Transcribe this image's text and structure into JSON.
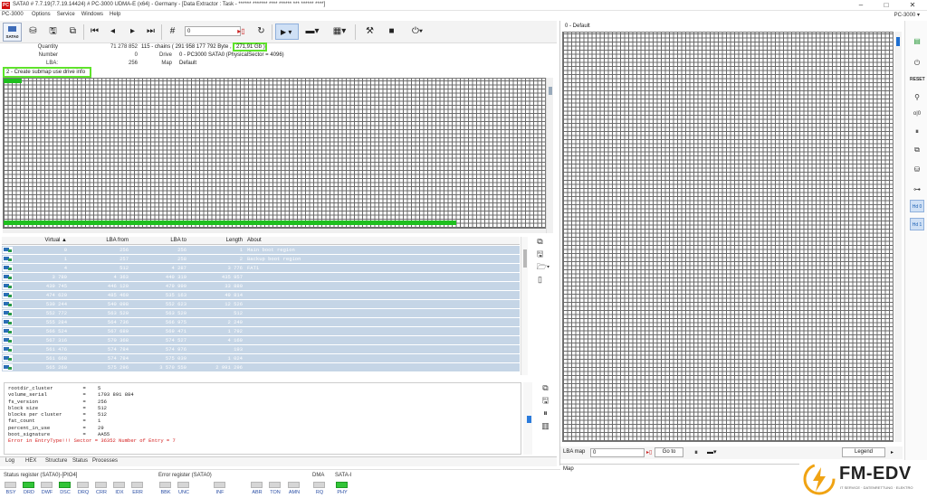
{
  "titlebar": {
    "title": "SATA0 # 7.7.19(7.7.19.14424) # PC-3000 UDMA-E (x64) - Germany - [Data Extractor : Task - ****** ******* **** ****** *** ****** ****]",
    "app_icon": "PC"
  },
  "menubar": {
    "app_label": "PC-3000",
    "items": [
      "Options",
      "Service",
      "Windows",
      "Help"
    ],
    "right_label": "PC-3000 ▾"
  },
  "toolbar": {
    "sata0_label": "SATA0",
    "lba_value": "0"
  },
  "info": {
    "quantity_label": "Quantity",
    "quantity_value": "71 278 852",
    "chains_text": "115 - chains ( 291 958 177 792 Byte ,",
    "size_highlight": "271,91 Gb )",
    "number_label": "Number",
    "number_value": "0",
    "drive_label": "Drive",
    "drive_value": "0 - PC3000 SATA0 (PhysicalSector = 4096)",
    "lba_label": "LBA:",
    "lba_value": "256",
    "map_label": "Map",
    "map_value": "Default"
  },
  "highlight_label": "2 - Create submap use drive info",
  "table": {
    "headers": [
      "Virtual ▲",
      "LBA from",
      "LBA to",
      "Length",
      "About"
    ],
    "rows": [
      [
        "0",
        "256",
        "256",
        "1",
        "Main boot region"
      ],
      [
        "1",
        "257",
        "258",
        "2",
        "Backup boot region"
      ],
      [
        "4",
        "512",
        "4 287",
        "3 776",
        "FAT1"
      ],
      [
        "3 780",
        "4 363",
        "440 319",
        "435 957",
        ""
      ],
      [
        "439 745",
        "446 120",
        "479 999",
        "33 880",
        ""
      ],
      [
        "474 620",
        "485 460",
        "535 163",
        "49 814",
        ""
      ],
      [
        "530 244",
        "540 098",
        "552 623",
        "12 526",
        ""
      ],
      [
        "552 772",
        "563 520",
        "563 520",
        "512",
        ""
      ],
      [
        "555 284",
        "564 736",
        "566 975",
        "2 240",
        ""
      ],
      [
        "566 524",
        "567 680",
        "569 471",
        "1 792",
        ""
      ],
      [
        "567 316",
        "570 368",
        "574 527",
        "4 160",
        ""
      ],
      [
        "561 476",
        "574 784",
        "574 976",
        "193",
        ""
      ],
      [
        "561 668",
        "574 784",
        "575 039",
        "1 024",
        ""
      ],
      [
        "565 260",
        "575 296",
        "3 570 559",
        "2 991 296",
        ""
      ]
    ]
  },
  "log": {
    "lines": [
      "rootdir_cluster          =    5",
      "volume_serial            =    1703 891 884",
      "fs_version               =    256",
      "block size               =    512",
      "blocks per cluster       =    512",
      "fat_count                =    1",
      "percent_in_use           =    29",
      "boot_signature           =    AA55"
    ],
    "error": "Error in EntryType!!! Sector = 36352 Number of Entry = 7"
  },
  "tabs": [
    "Log",
    "HEX",
    "Structure",
    "Status",
    "Processes"
  ],
  "status": {
    "status_title": "Status register (SATA0)-[PIO4]",
    "status_leds": [
      {
        "label": "BSY",
        "on": false
      },
      {
        "label": "DRD",
        "on": true
      },
      {
        "label": "DWF",
        "on": false
      },
      {
        "label": "DSC",
        "on": true
      },
      {
        "label": "DRQ",
        "on": false
      },
      {
        "label": "CRR",
        "on": false
      },
      {
        "label": "IDX",
        "on": false
      },
      {
        "label": "ERR",
        "on": false
      }
    ],
    "error_title": "Error register (SATA0)",
    "error_leds": [
      {
        "label": "BBK",
        "on": false
      },
      {
        "label": "UNC",
        "on": false
      },
      {
        "label": "INF",
        "on": false
      },
      {
        "label": "ABR",
        "on": false
      },
      {
        "label": "TON",
        "on": false
      },
      {
        "label": "AMN",
        "on": false
      }
    ],
    "dma_title": "DMA",
    "dma_led": {
      "label": "RQ",
      "on": false
    },
    "sata_title": "SATA-I",
    "sata_led": {
      "label": "PHY",
      "on": true
    }
  },
  "right_panel": {
    "title": "0 - Default",
    "lba_map_label": "LBA map",
    "lba_map_value": "0",
    "goto_label": "Go to",
    "legend_label": "Legend",
    "map_tab": "Map"
  },
  "right_toolbar": {
    "reset_label": "RESET",
    "hd0_label": "Hd 0",
    "hd1_label": "Hd 1"
  },
  "logo": {
    "name": "FM-EDV",
    "tagline": "IT SERVICE · DATENRETTUNG · ELEKTRO",
    "accent": "#f0a313"
  },
  "colors": {
    "highlight": "#5ee32b",
    "row_bg": "#c5d5e6",
    "selected": "#cfe0f5",
    "error_text": "#d31b1b",
    "led_on": "#32c437"
  }
}
